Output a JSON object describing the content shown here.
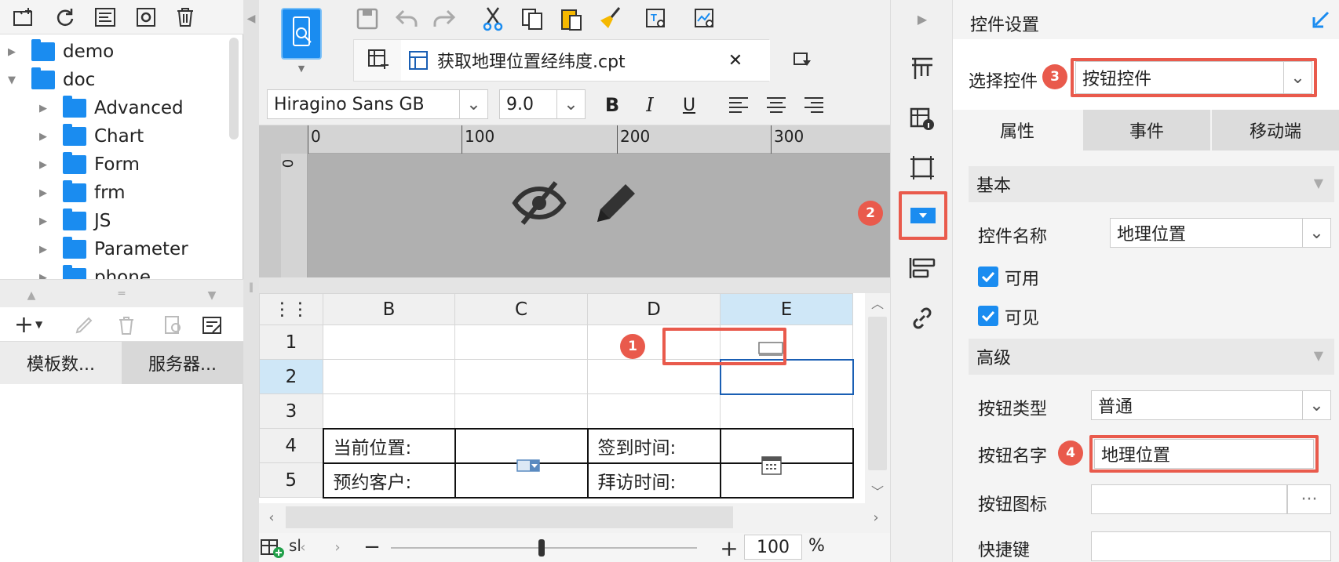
{
  "left_panel": {
    "tree": [
      {
        "label": "demo",
        "level": 0,
        "expanded": false
      },
      {
        "label": "doc",
        "level": 0,
        "expanded": true
      },
      {
        "label": "Advanced",
        "level": 1
      },
      {
        "label": "Chart",
        "level": 1
      },
      {
        "label": "Form",
        "level": 1
      },
      {
        "label": "frm",
        "level": 1
      },
      {
        "label": "JS",
        "level": 1
      },
      {
        "label": "Parameter",
        "level": 1
      },
      {
        "label": "phone",
        "level": 1
      }
    ],
    "tabs": [
      "模板数...",
      "服务器..."
    ]
  },
  "editor": {
    "file_tab": "获取地理位置经纬度.cpt",
    "font_name": "Hiragino Sans GB",
    "font_size": "9.0",
    "ruler_ticks": [
      "0",
      "100",
      "200",
      "300"
    ],
    "vruler_tick": "0",
    "columns": [
      "B",
      "C",
      "D",
      "E"
    ],
    "rows": [
      "1",
      "2",
      "3",
      "4",
      "5"
    ],
    "cells": {
      "b4": "当前位置:",
      "d4": "签到时间:",
      "b5": "预约客户:",
      "d5": "拜访时间:"
    },
    "sheet_tab": "sl",
    "zoom": "100",
    "zoom_unit": "%"
  },
  "right_panel": {
    "title": "控件设置",
    "select_label": "选择控件",
    "select_value": "按钮控件",
    "tabs": [
      "属性",
      "事件",
      "移动端"
    ],
    "section_basic": "基本",
    "name_label": "控件名称",
    "name_value": "地理位置",
    "enabled_label": "可用",
    "visible_label": "可见",
    "section_advanced": "高级",
    "type_label": "按钮类型",
    "type_value": "普通",
    "btn_name_label": "按钮名字",
    "btn_name_value": "地理位置",
    "btn_icon_label": "按钮图标",
    "btn_icon_more": "···",
    "hotkey_label": "快捷键"
  },
  "badges": [
    "1",
    "2",
    "3",
    "4"
  ],
  "colors": {
    "accent": "#1a8cf0",
    "highlight": "#e95a4c"
  }
}
